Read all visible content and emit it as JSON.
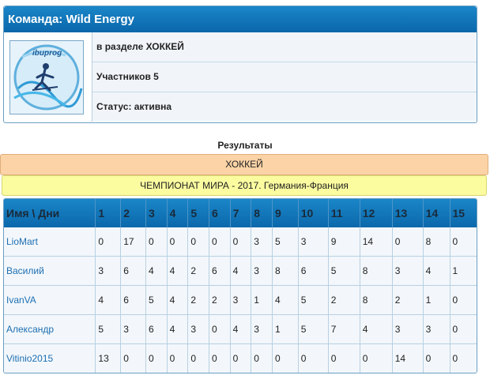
{
  "team": {
    "title": "Команда: Wild Energy",
    "logo_text": "ibuprog",
    "section": "в разделе ХОККЕЙ",
    "members": "Участников 5",
    "status": "Статус: активна"
  },
  "results": {
    "title": "Результаты",
    "sport": "ХОККЕЙ",
    "championship": "ЧЕМПИОНАТ МИРА - 2017. Германия-Франция",
    "header_name": "Имя \\ Дни",
    "days": [
      "1",
      "2",
      "3",
      "4",
      "5",
      "6",
      "7",
      "8",
      "9",
      "10",
      "11",
      "12",
      "13",
      "14",
      "15"
    ],
    "rows": [
      {
        "name": "LioMart",
        "values": [
          "0",
          "17",
          "0",
          "0",
          "0",
          "0",
          "0",
          "3",
          "5",
          "3",
          "9",
          "14",
          "0",
          "8",
          "0"
        ]
      },
      {
        "name": "Василий",
        "values": [
          "3",
          "6",
          "4",
          "4",
          "2",
          "6",
          "4",
          "3",
          "8",
          "6",
          "5",
          "8",
          "3",
          "4",
          "1"
        ]
      },
      {
        "name": "IvanVA",
        "values": [
          "4",
          "6",
          "5",
          "4",
          "2",
          "2",
          "3",
          "1",
          "4",
          "5",
          "2",
          "8",
          "2",
          "1",
          "0"
        ]
      },
      {
        "name": "Александр",
        "values": [
          "5",
          "3",
          "6",
          "4",
          "3",
          "0",
          "4",
          "3",
          "1",
          "5",
          "7",
          "4",
          "3",
          "3",
          "0"
        ]
      },
      {
        "name": "Vitinio2015",
        "values": [
          "13",
          "0",
          "0",
          "0",
          "0",
          "0",
          "0",
          "0",
          "0",
          "0",
          "0",
          "0",
          "14",
          "0",
          "0"
        ]
      }
    ]
  }
}
